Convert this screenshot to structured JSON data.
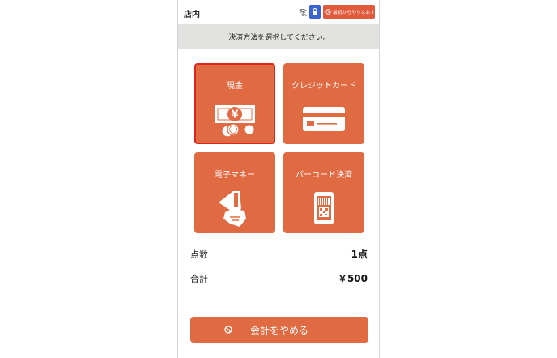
{
  "header": {
    "store_name": "店内",
    "wifi_icon": "wifi-off-icon",
    "lock_icon": "lock-icon",
    "restart_label": "最初からやりなおす",
    "restart_color": "#e15a3c",
    "lock_color": "#3a63d2"
  },
  "instruction": "決済方法を選択してください。",
  "payment_methods": [
    {
      "label": "現金",
      "icon": "cash-icon",
      "selected": true
    },
    {
      "label": "クレジットカード",
      "icon": "credit-card-icon",
      "selected": false
    },
    {
      "label": "電子マネー",
      "icon": "card-reader-icon",
      "selected": false
    },
    {
      "label": "バーコード決済",
      "icon": "barcode-phone-icon",
      "selected": false
    }
  ],
  "summary": {
    "count_label": "点数",
    "count_value": "1点",
    "total_label": "合計",
    "total_value": "￥500"
  },
  "cancel_button": {
    "label": "会計をやめる",
    "icon": "ban-icon"
  },
  "colors": {
    "accent": "#e06a42",
    "selected_border": "#e0251a",
    "banner_bg": "#e2e2e0"
  }
}
